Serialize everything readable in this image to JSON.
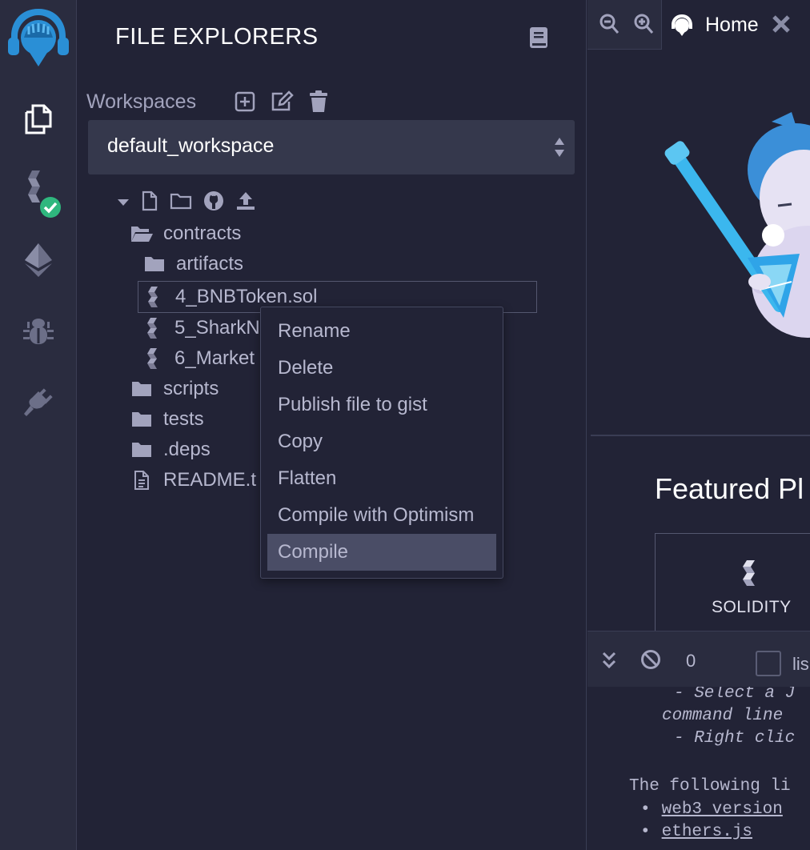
{
  "sidebar_icons": [
    "remix-logo-icon",
    "file-explorers-icon",
    "solidity-compiler-icon",
    "deploy-run-icon",
    "debugger-icon",
    "plugin-manager-icon"
  ],
  "panel": {
    "title": "FILE EXPLORERS",
    "workspaces_label": "Workspaces",
    "workspace_selected": "default_workspace"
  },
  "tree": {
    "items": [
      {
        "label": "contracts",
        "icon": "folder-open-icon"
      },
      {
        "label": "artifacts",
        "icon": "folder-icon"
      },
      {
        "label": "4_BNBToken.sol",
        "icon": "solidity-file-icon"
      },
      {
        "label": "5_SharkN",
        "icon": "solidity-file-icon"
      },
      {
        "label": "6_Market",
        "icon": "solidity-file-icon"
      },
      {
        "label": "scripts",
        "icon": "folder-icon"
      },
      {
        "label": "tests",
        "icon": "folder-icon"
      },
      {
        "label": ".deps",
        "icon": "folder-icon"
      },
      {
        "label": "README.t",
        "icon": "text-file-icon"
      }
    ]
  },
  "context_menu": {
    "items": [
      "Rename",
      "Delete",
      "Publish file to gist",
      "Copy",
      "Flatten",
      "Compile with Optimism",
      "Compile"
    ],
    "active_index": 6
  },
  "main": {
    "tab_label": "Home",
    "featured_heading": "Featured Pl",
    "featured_card_label": "SOLIDITY"
  },
  "terminal": {
    "count": "0",
    "listen_label": "lis",
    "lines": [
      "- Select a J",
      "command line",
      "- Right clic",
      "The following li",
      "web3 version",
      "ethers.js"
    ]
  },
  "colors": {
    "background": "#222336",
    "sidebar": "#2a2c3f",
    "accent_blue": "#2a8fd6",
    "success_green": "#2fb77e",
    "menu_active": "#4a4d66"
  }
}
